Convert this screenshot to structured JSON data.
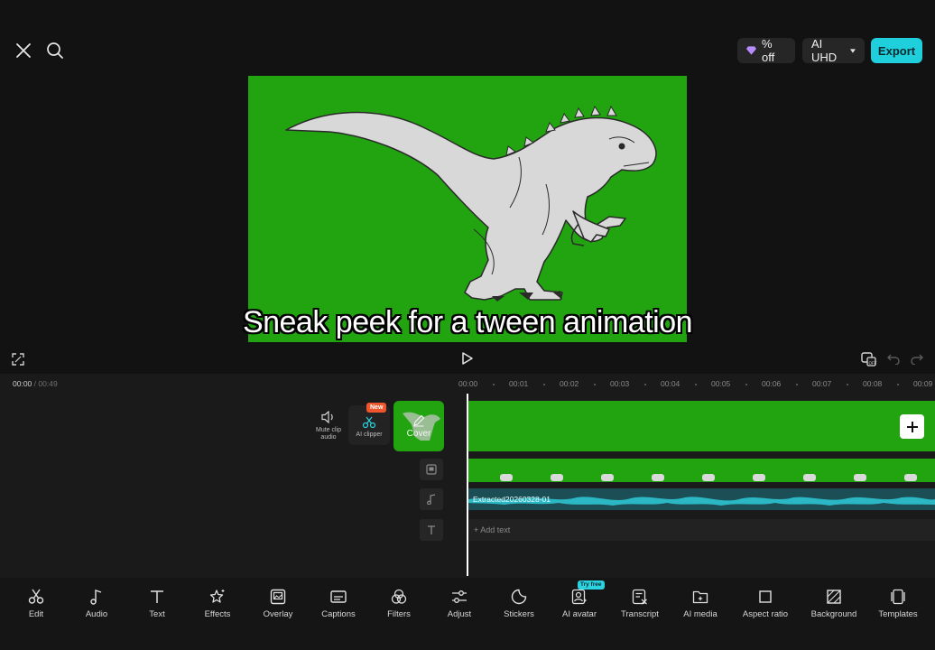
{
  "header": {
    "discount_label": "% off",
    "quality_label": "AI UHD",
    "export_label": "Export"
  },
  "preview": {
    "caption": "Sneak peek for a tween animation",
    "background_color": "#21a40f"
  },
  "playback": {
    "current_time": "00:00",
    "separator": "/",
    "total_time": "00:49"
  },
  "ruler": [
    "00:00",
    "00:01",
    "00:02",
    "00:03",
    "00:04",
    "00:05",
    "00:06",
    "00:07",
    "00:08",
    "00:09"
  ],
  "side_tools": {
    "mute_label_1": "Mute clip",
    "mute_label_2": "audio",
    "ai_clipper_label": "AI clipper",
    "new_badge": "New",
    "cover_label": "Cover"
  },
  "tracks": {
    "audio_clip_name": "Extracted20260328-01",
    "add_text_label": "+ Add text"
  },
  "toolbar": {
    "items": [
      {
        "label": "Edit",
        "icon": "scissors-icon"
      },
      {
        "label": "Audio",
        "icon": "music-note-icon"
      },
      {
        "label": "Text",
        "icon": "text-icon"
      },
      {
        "label": "Effects",
        "icon": "sparkle-star-icon"
      },
      {
        "label": "Overlay",
        "icon": "overlay-icon"
      },
      {
        "label": "Captions",
        "icon": "captions-icon"
      },
      {
        "label": "Filters",
        "icon": "filters-icon"
      },
      {
        "label": "Adjust",
        "icon": "sliders-icon"
      },
      {
        "label": "Stickers",
        "icon": "sticker-icon"
      },
      {
        "label": "AI avatar",
        "icon": "avatar-icon"
      },
      {
        "label": "Transcript",
        "icon": "transcript-icon"
      },
      {
        "label": "AI media",
        "icon": "ai-media-icon"
      },
      {
        "label": "Aspect ratio",
        "icon": "aspect-ratio-icon"
      },
      {
        "label": "Background",
        "icon": "background-icon"
      },
      {
        "label": "Templates",
        "icon": "templates-icon"
      }
    ],
    "try_free_badge": "Try free"
  },
  "colors": {
    "accent": "#1fcfdc",
    "green_screen": "#21a40f",
    "audio_wave": "#2bb8c4",
    "new_badge": "#f0562e"
  }
}
